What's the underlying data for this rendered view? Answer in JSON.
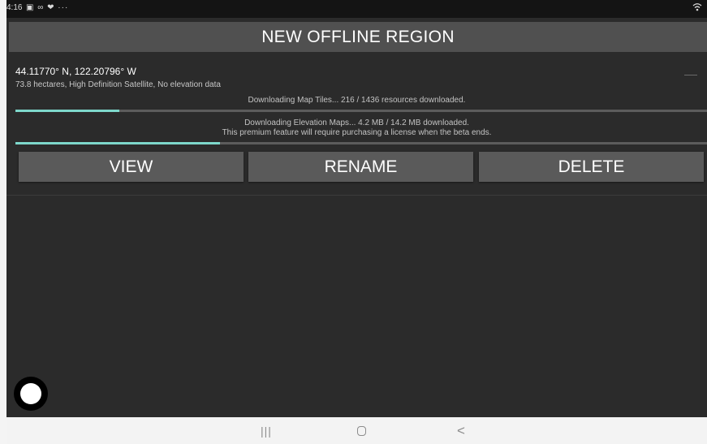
{
  "status_bar": {
    "time": "4:16",
    "left_icons": "▣ ∞ ❤ ···",
    "wifi_icon": "wifi-icon"
  },
  "header": {
    "title": "NEW OFFLINE REGION"
  },
  "region": {
    "coordinates": "44.11770° N, 122.20796° W",
    "details": "73.8 hectares, High Definition Satellite, No elevation data",
    "tiles_status": "Downloading Map Tiles... 216 / 1436 resources downloaded.",
    "tiles_progress": 0.15,
    "elevation_status_line1": "Downloading Elevation Maps... 4.2 MB / 14.2 MB downloaded.",
    "elevation_status_line2": "This premium feature will require purchasing a license when the beta ends.",
    "elevation_progress": 0.296
  },
  "actions": {
    "view_label": "VIEW",
    "rename_label": "RENAME",
    "delete_label": "DELETE"
  },
  "nav_bar": {
    "recent_label": "|||",
    "back_label": "<"
  },
  "colors": {
    "background": "#2b2b2b",
    "header": "#505050",
    "button": "#5a5a5a",
    "progress_fill": "#7ed8cb",
    "progress_track": "#5c5c5c"
  }
}
